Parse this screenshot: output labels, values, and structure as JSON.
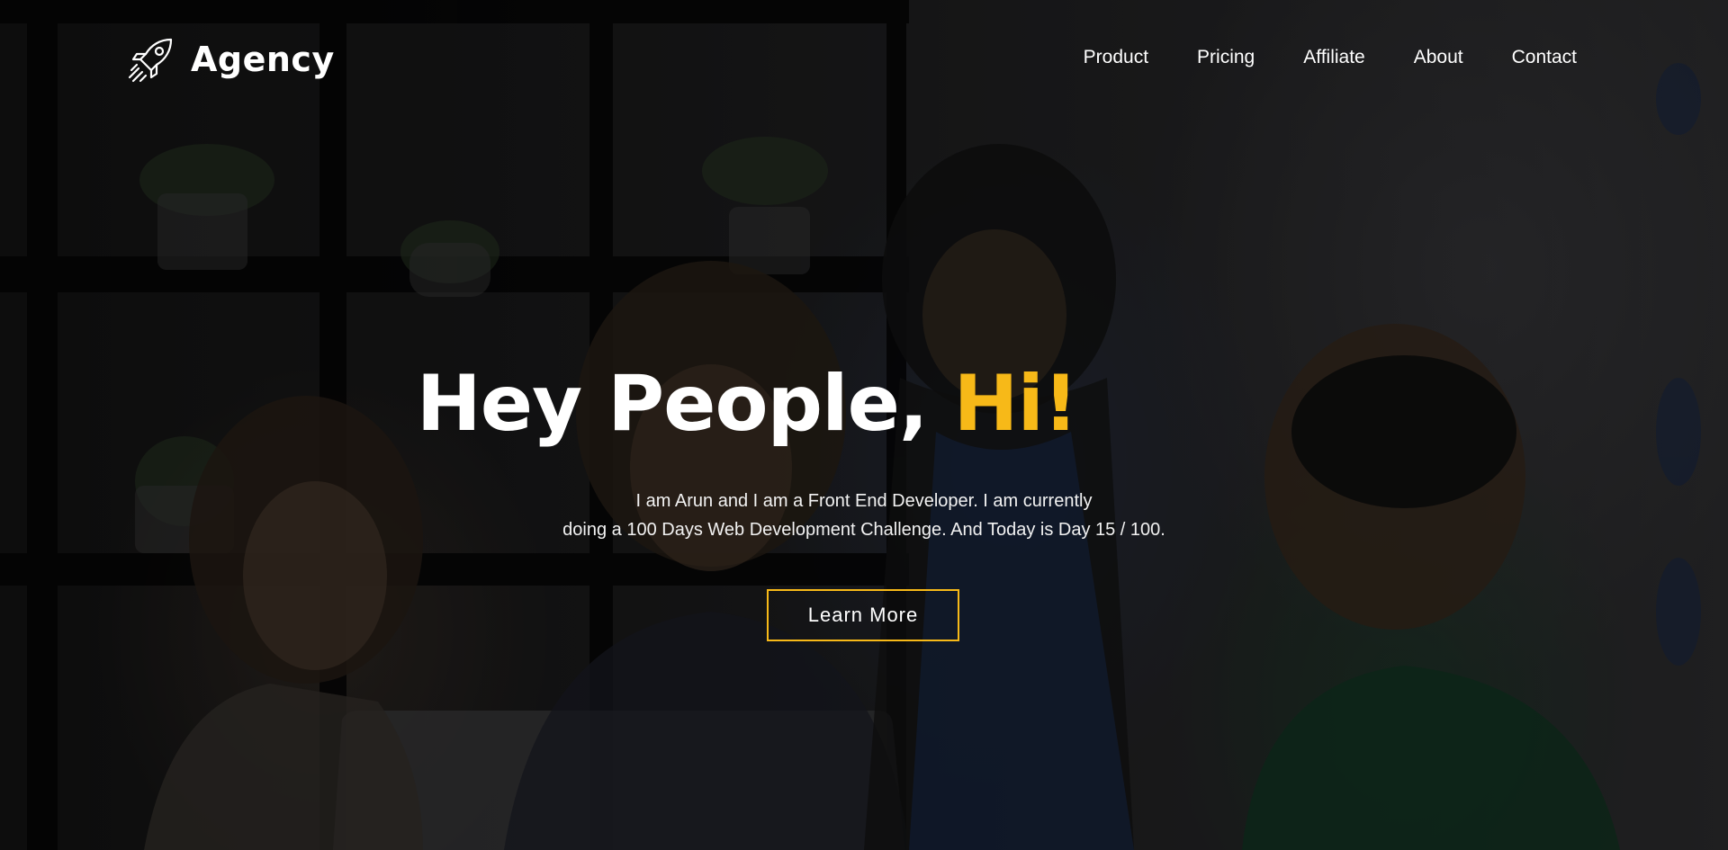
{
  "header": {
    "brand": "Agency",
    "logo_icon": "rocket-icon",
    "nav": [
      {
        "label": "Product"
      },
      {
        "label": "Pricing"
      },
      {
        "label": "Affiliate"
      },
      {
        "label": "About"
      },
      {
        "label": "Contact"
      }
    ]
  },
  "hero": {
    "headline_main": "Hey People, ",
    "headline_accent": "Hi!",
    "subtitle_line1": "I am Arun and I am a Front End Developer. I am currently",
    "subtitle_line2": "doing a 100 Days Web Development Challenge. And Today is Day 15 / 100.",
    "cta_label": "Learn More"
  },
  "colors": {
    "accent": "#f7b918",
    "text": "#ffffff",
    "background": "#1c1c1d"
  }
}
